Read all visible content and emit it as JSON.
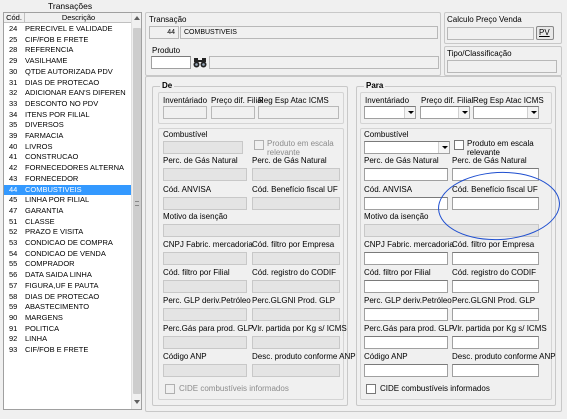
{
  "list": {
    "header_title": "Transações",
    "col_code": "Cód.",
    "col_desc": "Descrição",
    "rows": [
      [
        "24",
        "PERECIVEL E VALIDADE"
      ],
      [
        "25",
        "CIF/FOB E FRETE"
      ],
      [
        "28",
        "REFERENCIA"
      ],
      [
        "29",
        "VASILHAME"
      ],
      [
        "30",
        "QTDE AUTORIZADA PDV"
      ],
      [
        "31",
        "DIAS DE PROTECAO"
      ],
      [
        "32",
        "ADICIONAR EAN'S DIFEREN"
      ],
      [
        "33",
        "DESCONTO NO PDV"
      ],
      [
        "34",
        "ITENS POR FILIAL"
      ],
      [
        "35",
        "DIVERSOS"
      ],
      [
        "39",
        "FARMACIA"
      ],
      [
        "40",
        "LIVROS"
      ],
      [
        "41",
        "CONSTRUCAO"
      ],
      [
        "42",
        "FORNECEDORES ALTERNA"
      ],
      [
        "43",
        "FORNECEDOR"
      ],
      [
        "44",
        "COMBUSTIVEIS"
      ],
      [
        "45",
        "LINHA POR FILIAL"
      ],
      [
        "47",
        "GARANTIA"
      ],
      [
        "51",
        "CLASSE"
      ],
      [
        "52",
        "PRAZO E VISITA"
      ],
      [
        "53",
        "CONDICAO DE COMPRA"
      ],
      [
        "54",
        "CONDICAO DE VENDA"
      ],
      [
        "55",
        "COMPRADOR"
      ],
      [
        "56",
        "DATA SAIDA LINHA"
      ],
      [
        "57",
        "FIGURA,UF E PAUTA"
      ],
      [
        "58",
        "DIAS DE PROTECAO"
      ],
      [
        "59",
        "ABASTECIMENTO"
      ],
      [
        "90",
        "MARGENS"
      ],
      [
        "91",
        "POLITICA"
      ],
      [
        "92",
        "LINHA"
      ],
      [
        "93",
        "CIF/FOB E FRETE"
      ]
    ],
    "selected_code": "44"
  },
  "transacao": {
    "label": "Transação",
    "code": "44",
    "name": "COMBUSTIVEIS"
  },
  "produto": {
    "label": "Produto",
    "binoculars_icon": "binoculars-icon"
  },
  "calculo": {
    "label": "Calculo Preço Venda",
    "button": "PV"
  },
  "tipo": {
    "label": "Tipo/Classificação"
  },
  "de": {
    "title": "De",
    "inventariado": "Inventáriado",
    "preco_dif_filial": "Preço dif. Filial",
    "reg_esp": "Reg Esp Atac ICMS",
    "combustivel": "Combustível",
    "produto_escala": "Produto em escala relevante",
    "perc_gas_natural_1": "Perc. de Gás Natural",
    "perc_gas_natural_2": "Perc. de  Gás Natural",
    "cod_anvisa": "Cód. ANVISA",
    "cod_beneficio": "Cód. Benefício fiscal UF",
    "motivo_isencao": "Motivo da isenção",
    "cnpj_fabric": "CNPJ Fabric. mercadoria",
    "cod_filtro_empresa": "Cód. filtro por Empresa",
    "cod_filtro_filial": "Cód. filtro por Filial",
    "cod_registro_codif": "Cód. registro do CODIF",
    "perc_glp_deriv": "Perc. GLP deriv.Petróleo",
    "perc_glgni": "Perc.GLGNI Prod. GLP",
    "perc_gas_prod_glp": "Perc.Gás para prod. GLP",
    "vlr_partida": "Vlr. partida por Kg s/ ICMS",
    "codigo_anp": "Código ANP",
    "desc_produto_anp": "Desc. produto conforme ANP",
    "cide": "CIDE combustíveis informados"
  },
  "para": {
    "title": "Para",
    "inventariado": "Inventáriado",
    "preco_dif_filial": "Preço dif. Filial",
    "reg_esp": "Reg Esp Atac ICMS",
    "combustivel": "Combustível",
    "produto_escala": "Produto em escala relevante",
    "perc_gas_natural_1": "Perc. de  Gás Natural",
    "perc_gas_natural_2": "Perc. de  Gás Natural",
    "cod_anvisa": "Cód. ANVISA",
    "cod_beneficio": "Cód. Benefício fiscal UF",
    "motivo_isencao": "Motivo da isenção",
    "cnpj_fabric": "CNPJ Fabric. mercadoria",
    "cod_filtro_empresa": "Cód. filtro por Empresa",
    "cod_filtro_filial": "Cód. filtro por Filial",
    "cod_registro_codif": "Cód. registro do CODIF",
    "perc_glp_deriv": "Perc. GLP deriv.Petróleo",
    "perc_glgni": "Perc.GLGNI Prod. GLP",
    "perc_gas_prod_glp": "Perc.Gás para prod. GLP",
    "vlr_partida": "Vlr. partida por Kg s/ ICMS",
    "codigo_anp": "Código ANP",
    "desc_produto_anp": "Desc. produto conforme ANP",
    "cide": "CIDE combustíveis informados"
  },
  "annotation_color": "#1f4fd0",
  "selection_color": "#3399ff"
}
